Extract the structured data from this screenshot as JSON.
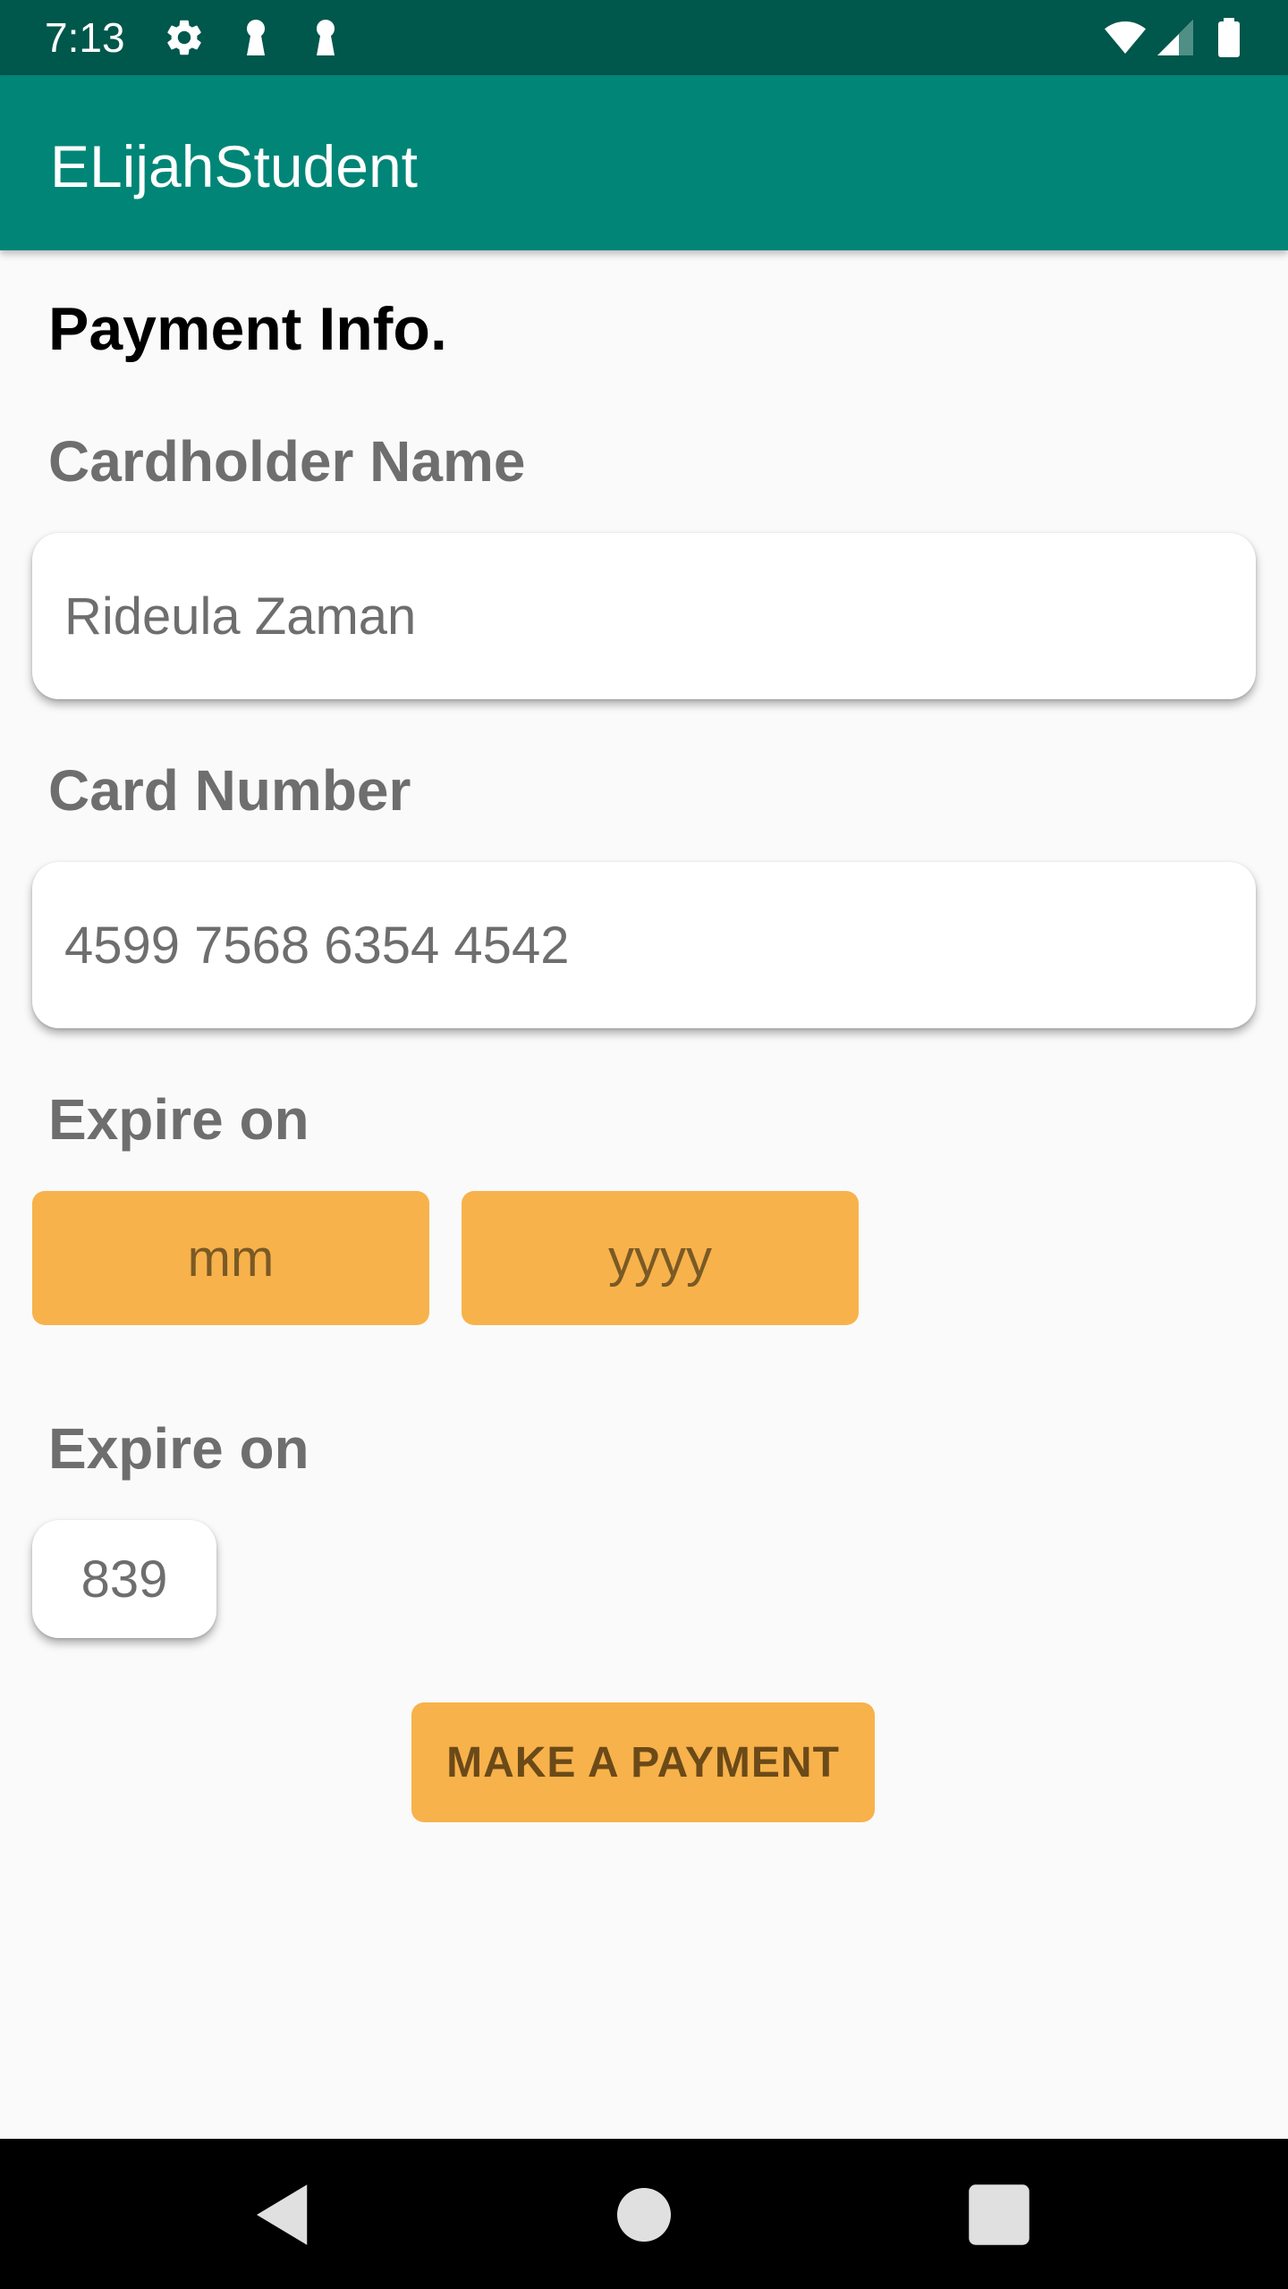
{
  "status_bar": {
    "time": "7:13",
    "icons": [
      "gear-icon",
      "keyhole-icon",
      "keyhole-icon",
      "wifi-icon",
      "signal-icon",
      "battery-icon"
    ]
  },
  "app_bar": {
    "title": "ELijahStudent"
  },
  "main": {
    "section_title": "Payment Info.",
    "cardholder_label": "Cardholder Name",
    "cardholder_value": "Rideula Zaman",
    "card_number_label": "Card Number",
    "card_number_value": "4599 7568 6354 4542",
    "expire_label": "Expire on",
    "month_button": "mm",
    "year_button": "yyyy",
    "cvv_label": "Expire on",
    "cvv_value": "839",
    "pay_button": "MAKE A PAYMENT"
  },
  "nav_bar": {
    "icons": [
      "back-icon",
      "home-icon",
      "recents-icon"
    ]
  },
  "colors": {
    "status_bar": "#00574b",
    "app_bar": "#008577",
    "accent": "#f8b24b",
    "background": "#fafafa"
  }
}
